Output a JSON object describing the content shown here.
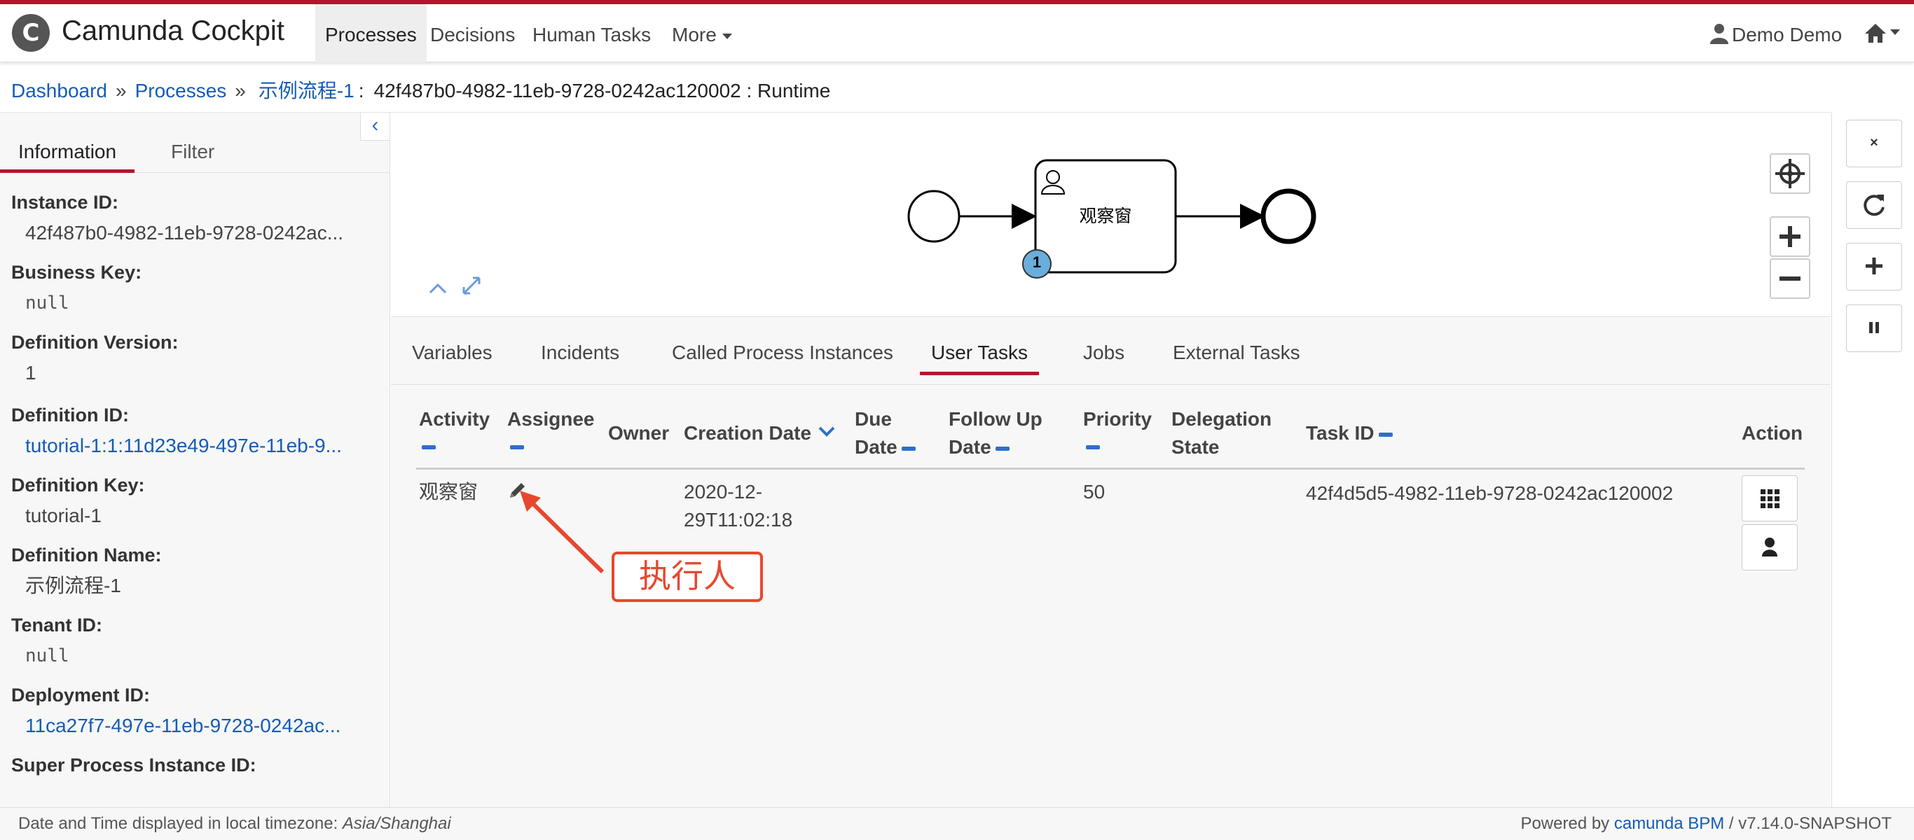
{
  "app": {
    "logo_letter": "C",
    "title": "Camunda Cockpit"
  },
  "nav": {
    "items": [
      {
        "label": "Processes",
        "active": true
      },
      {
        "label": "Decisions"
      },
      {
        "label": "Human Tasks"
      },
      {
        "label": "More"
      }
    ],
    "user": "Demo Demo"
  },
  "breadcrumb": {
    "dashboard": "Dashboard",
    "processes": "Processes",
    "process": "示例流程-1",
    "instance": "42f487b0-4982-11eb-9728-0242ac120002 : Runtime"
  },
  "sidebar": {
    "tabs": [
      "Information",
      "Filter"
    ],
    "fields": [
      {
        "label": "Instance ID:",
        "value": "42f487b0-4982-11eb-9728-0242ac..."
      },
      {
        "label": "Business Key:",
        "value": "null"
      },
      {
        "label": "Definition Version:",
        "value": "1"
      },
      {
        "label": "Definition ID:",
        "value": "tutorial-1:1:11d23e49-497e-11eb-9..."
      },
      {
        "label": "Definition Key:",
        "value": "tutorial-1"
      },
      {
        "label": "Definition Name:",
        "value": "示例流程-1"
      },
      {
        "label": "Tenant ID:",
        "value": "null"
      },
      {
        "label": "Deployment ID:",
        "value": "11ca27f7-497e-11eb-9728-0242ac..."
      },
      {
        "label": "Super Process Instance ID:",
        "value": ""
      }
    ]
  },
  "diagram": {
    "task_name": "观察窗",
    "token_count": "1"
  },
  "tabs": [
    "Variables",
    "Incidents",
    "Called Process Instances",
    "User Tasks",
    "Jobs",
    "External Tasks"
  ],
  "active_tab": "User Tasks",
  "table": {
    "headers": {
      "activity": "Activity",
      "assignee": "Assignee",
      "owner": "Owner",
      "creation_date": "Creation Date",
      "due_date_1": "Due",
      "due_date_2": "Date",
      "follow_up_1": "Follow Up",
      "follow_up_2": "Date",
      "priority": "Priority",
      "delegation_1": "Delegation",
      "delegation_2": "State",
      "task_id": "Task ID",
      "action": "Action"
    },
    "rows": [
      {
        "activity": "观察窗",
        "creation_date_1": "2020-12-",
        "creation_date_2": "29T11:02:18",
        "priority": "50",
        "task_id": "42f4d5d5-4982-11eb-9728-0242ac120002"
      }
    ]
  },
  "annotation": {
    "text": "执行人"
  },
  "footer": {
    "timezone_prefix": "Date and Time displayed in local timezone: ",
    "timezone": "Asia/Shanghai",
    "powered_prefix": "Powered by ",
    "powered_link": "camunda BPM",
    "version": " / v7.14.0-SNAPSHOT"
  },
  "colors": {
    "accent": "#b5152b",
    "link": "#155cb5",
    "annotation": "#e8472f",
    "token": "#6aaedc"
  }
}
